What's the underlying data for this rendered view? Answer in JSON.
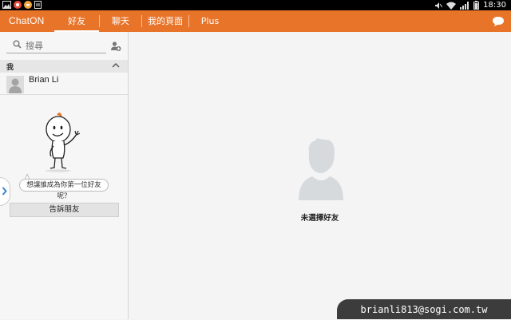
{
  "status_bar": {
    "time": "18:30",
    "left_icons": [
      "image-icon",
      "notification-icon",
      "chaton-icon",
      "clipboard-icon"
    ],
    "right_icons": [
      "mute-icon",
      "wifi-icon",
      "signal-icon",
      "battery-icon"
    ]
  },
  "top_bar": {
    "app_title": "ChatON",
    "tabs": [
      {
        "label": "好友",
        "selected": true
      },
      {
        "label": "聊天",
        "selected": false
      },
      {
        "label": "我的頁面",
        "selected": false
      },
      {
        "label": "Plus",
        "selected": false
      }
    ],
    "chat_icon": "chat-bubble-icon"
  },
  "sidebar": {
    "search_placeholder": "搜尋",
    "section_label": "我",
    "friends": [
      {
        "name": "Brian Li"
      }
    ],
    "bubble_text": "想讓誰成為你第一位好友呢？",
    "tell_friends_label": "告訴朋友"
  },
  "main": {
    "empty_label": "未選擇好友"
  },
  "watermark": "brianli813@sogi.com.tw",
  "colors": {
    "accent": "#e8742a",
    "background": "#f4f4f4"
  }
}
